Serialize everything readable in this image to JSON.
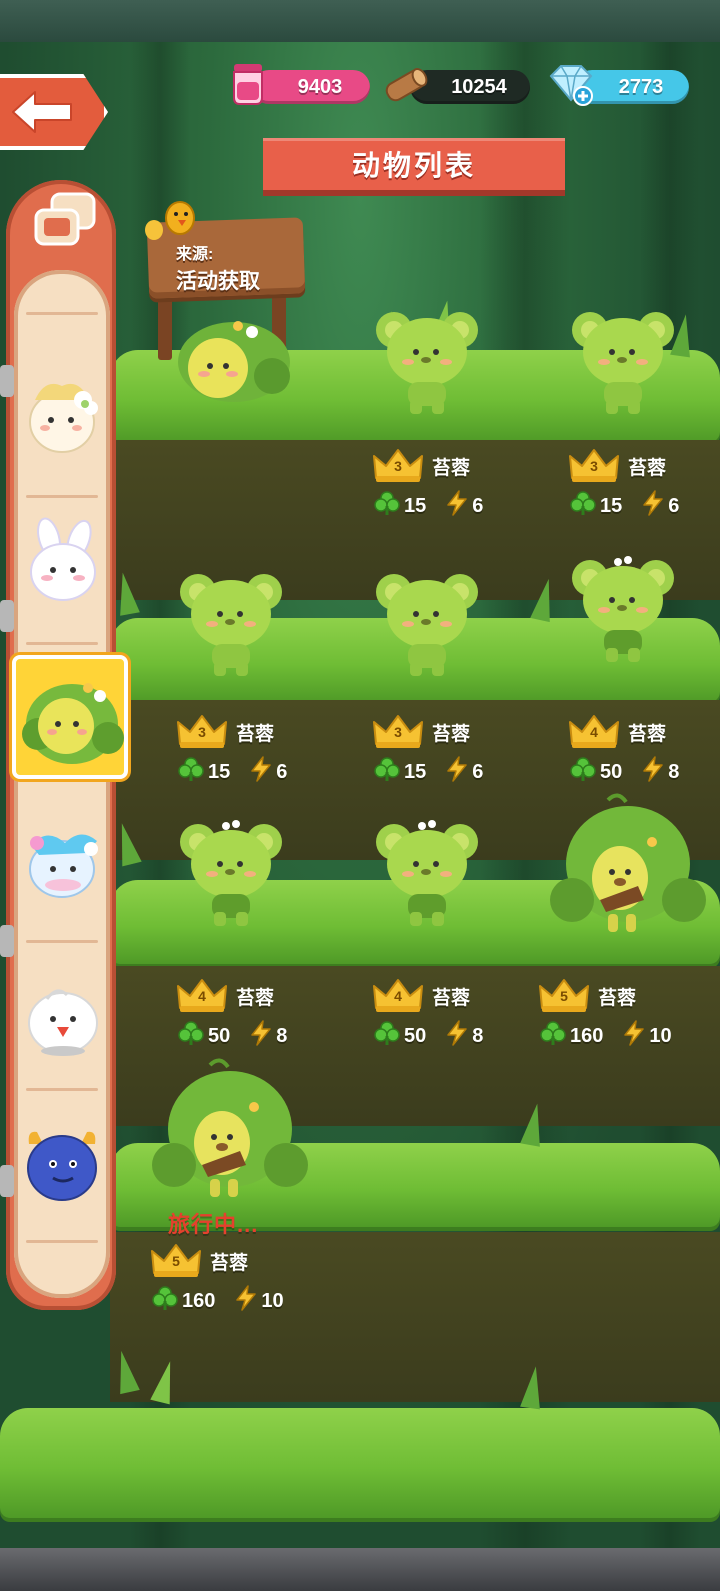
{
  "resources": {
    "jar": {
      "icon": "pink-jar-icon",
      "value": "9403"
    },
    "wood": {
      "icon": "wood-log-icon",
      "value": "10254"
    },
    "gem": {
      "icon": "blue-gem-add-icon",
      "value": "2773"
    }
  },
  "header": {
    "title": "动物列表",
    "back_icon": "back-arrow-icon"
  },
  "sign": {
    "label": "来源:",
    "value": "活动获取"
  },
  "sidebar": {
    "top_button_icon": "collection-icon",
    "animals": [
      {
        "name": "bunny-flower-animal"
      },
      {
        "name": "white-bunny-animal"
      },
      {
        "name": "moss-animal",
        "selected": true
      },
      {
        "name": "blue-ribbon-animal"
      },
      {
        "name": "white-bird-animal"
      },
      {
        "name": "blue-devil-animal"
      }
    ]
  },
  "cards": [
    {
      "level": "3",
      "name": "苔蓉",
      "clover": "15",
      "energy": "6"
    },
    {
      "level": "3",
      "name": "苔蓉",
      "clover": "15",
      "energy": "6"
    },
    {
      "level": "3",
      "name": "苔蓉",
      "clover": "15",
      "energy": "6"
    },
    {
      "level": "3",
      "name": "苔蓉",
      "clover": "15",
      "energy": "6"
    },
    {
      "level": "4",
      "name": "苔蓉",
      "clover": "50",
      "energy": "8"
    },
    {
      "level": "4",
      "name": "苔蓉",
      "clover": "50",
      "energy": "8"
    },
    {
      "level": "4",
      "name": "苔蓉",
      "clover": "50",
      "energy": "8"
    },
    {
      "level": "5",
      "name": "苔蓉",
      "clover": "160",
      "energy": "10"
    },
    {
      "level": "5",
      "name": "苔蓉",
      "clover": "160",
      "energy": "10"
    }
  ],
  "status": {
    "traveling": "旅行中..."
  },
  "colors": {
    "grass": "#79c43b",
    "soil": "#3f401f",
    "accent": "#e8604a",
    "crown": "#f6c232"
  }
}
